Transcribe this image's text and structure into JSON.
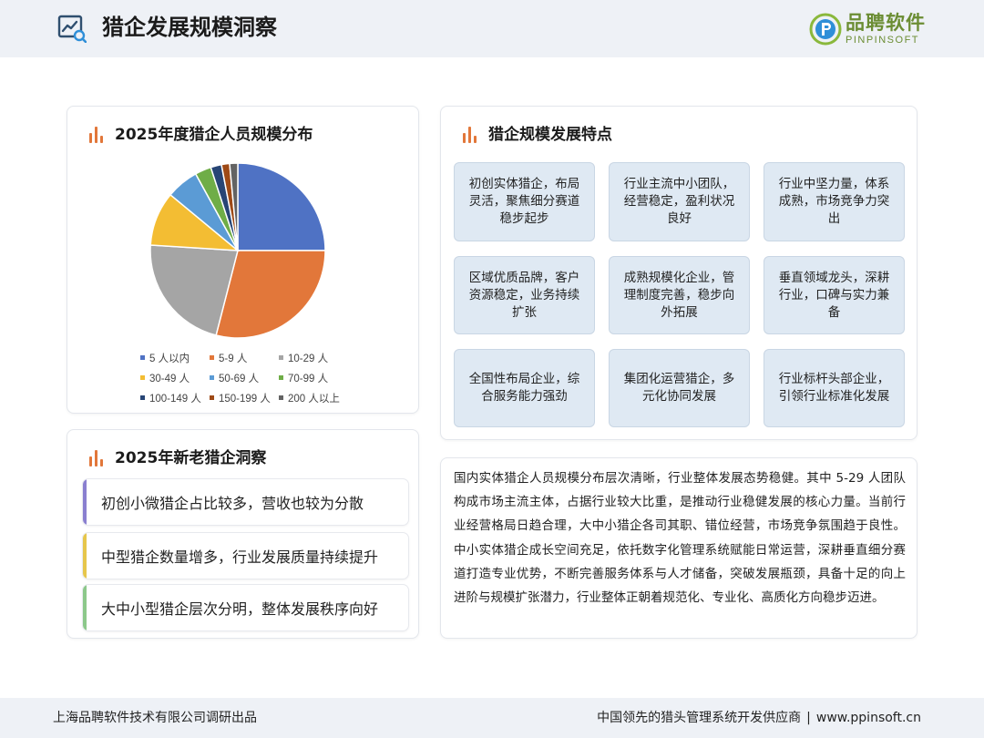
{
  "header": {
    "title": "猎企发展规模洞察",
    "logo_cn": "品聘软件",
    "logo_en": "PINPINSOFT"
  },
  "pie_card": {
    "title": "2025年度猎企人员规模分布"
  },
  "chart_data": {
    "type": "pie",
    "categories": [
      "5 人以内",
      "5-9 人",
      "10-29 人",
      "30-49 人",
      "50-69 人",
      "70-99 人",
      "100-149 人",
      "150-199 人",
      "200 人以上"
    ],
    "values": [
      25,
      29,
      22,
      10,
      6,
      3,
      2,
      1.5,
      1.5
    ],
    "colors": [
      "#4f72c4",
      "#e2773a",
      "#a5a5a5",
      "#f3bd33",
      "#5b9bd5",
      "#6fad47",
      "#274575",
      "#9e4a17",
      "#636363"
    ],
    "title": "",
    "legend": "bottom"
  },
  "features_card": {
    "title": "猎企规模发展特点",
    "items": [
      "初创实体猎企，布局灵活，聚焦细分赛道稳步起步",
      "行业主流中小团队，经营稳定，盈利状况良好",
      "行业中坚力量，体系成熟，市场竞争力突出",
      "区域优质品牌，客户资源稳定，业务持续扩张",
      "成熟规模化企业，管理制度完善，稳步向外拓展",
      "垂直领域龙头，深耕行业，口碑与实力兼备",
      "全国性布局企业，综合服务能力强劲",
      "集团化运营猎企，多元化协同发展",
      "行业标杆头部企业，引领行业标准化发展"
    ]
  },
  "insight_card": {
    "title": "2025年新老猎企洞察",
    "items": [
      "初创小微猎企占比较多，营收也较为分散",
      "中型猎企数量增多，行业发展质量持续提升",
      "大中小型猎企层次分明，整体发展秩序向好"
    ]
  },
  "summary": {
    "text": "国内实体猎企人员规模分布层次清晰，行业整体发展态势稳健。其中 5-29 人团队构成市场主流主体，占据行业较大比重，是推动行业稳健发展的核心力量。当前行业经营格局日趋合理，大中小猎企各司其职、错位经营，市场竞争氛围趋于良性。中小实体猎企成长空间充足，依托数字化管理系统赋能日常运营，深耕垂直细分赛道打造专业优势，不断完善服务体系与人才储备，突破发展瓶颈，具备十足的向上进阶与规模扩张潜力，行业整体正朝着规范化、专业化、高质化方向稳步迈进。"
  },
  "footer": {
    "left": "上海品聘软件技术有限公司调研出品",
    "right_main": "中国领先的猎头管理系统开发供应商",
    "separator": "|",
    "right_url": "www.ppinsoft.cn"
  }
}
